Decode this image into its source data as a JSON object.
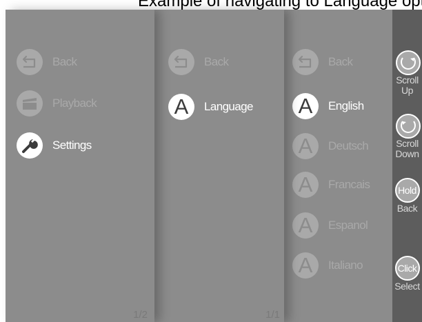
{
  "caption": "Example of navigating to Language options",
  "main_menu": {
    "items": [
      {
        "label": "Back",
        "icon": "back-arrow-icon",
        "active": false
      },
      {
        "label": "Playback",
        "icon": "clapperboard-icon",
        "active": false
      },
      {
        "label": "Settings",
        "icon": "wrench-icon",
        "active": true
      }
    ],
    "page": "1/2"
  },
  "settings_menu": {
    "items": [
      {
        "label": "Back",
        "icon": "back-arrow-icon",
        "active": false
      },
      {
        "label": "Language",
        "icon": "letter-a-icon",
        "glyph": "A",
        "active": true
      }
    ],
    "page": "1/1"
  },
  "language_menu": {
    "items": [
      {
        "label": "Back",
        "icon": "back-arrow-icon",
        "active": false
      },
      {
        "label": "English",
        "icon": "letter-a-icon",
        "glyph": "A",
        "active": true
      },
      {
        "label": "Deutsch",
        "icon": "letter-a-icon",
        "glyph": "A",
        "active": false
      },
      {
        "label": "Francais",
        "icon": "letter-a-icon",
        "glyph": "A",
        "active": false
      },
      {
        "label": "Espanol",
        "icon": "letter-a-icon",
        "glyph": "A",
        "active": false
      },
      {
        "label": "Italiano",
        "icon": "letter-a-icon",
        "glyph": "A",
        "active": false
      }
    ]
  },
  "hints": {
    "scroll_up": "Scroll Up",
    "scroll_down": "Scroll Down",
    "hold_badge": "Hold",
    "hold_caption": "Back",
    "click_badge": "Click",
    "click_caption": "Select"
  },
  "colors": {
    "panel": "#8c8c8c",
    "hint_bar": "#5d5d5d",
    "active_text": "#ffffff",
    "dim_text": "#a9a9a9"
  }
}
